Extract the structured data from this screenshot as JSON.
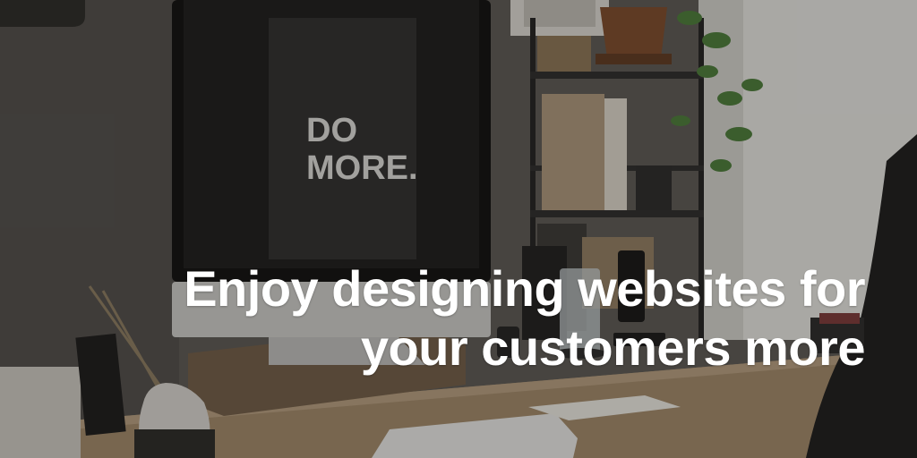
{
  "headline": {
    "line1": "Enjoy designing websites for",
    "line2": "your customers more"
  },
  "monitor_text": {
    "line1": "DO",
    "line2": "MORE."
  },
  "colors": {
    "wall": "#5c5a56",
    "window_light": "#d9d9d5",
    "desk": "#a68d70",
    "headline_text": "#ffffff",
    "overlay": "#141210"
  }
}
